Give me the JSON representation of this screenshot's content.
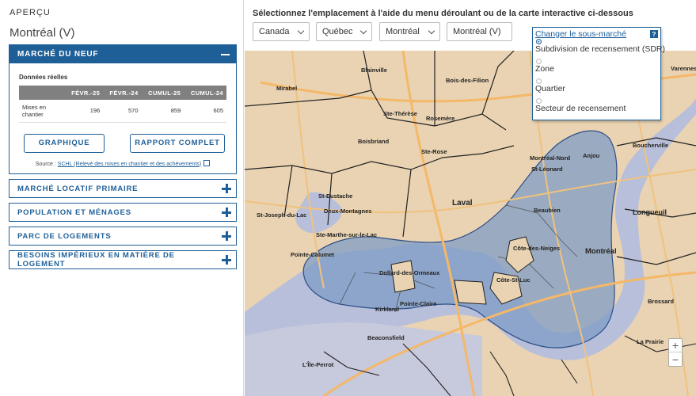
{
  "panel": {
    "overview_label": "APERÇU",
    "geo_name": "Montréal (V)",
    "open_section": {
      "title": "MARCHÉ DU NEUF",
      "data_label": "Données réelles",
      "columns": [
        "FÉVR.-25",
        "FÉVR.-24",
        "CUMUL-25",
        "CUMUL-24"
      ],
      "row_label": "Mises en chantier",
      "row_values": [
        "196",
        "570",
        "859",
        "605"
      ],
      "button_chart": "GRAPHIQUE",
      "button_report": "RAPPORT COMPLET",
      "source_prefix": "Source : ",
      "source_link": "SCHL (Relevé des mises en chantier et des achèvements)"
    },
    "sections": [
      "MARCHÉ LOCATIF PRIMAIRE",
      "POPULATION ET MÉNAGES",
      "PARC DE LOGEMENTS",
      "BESOINS IMPÉRIEUX EN MATIÈRE DE LOGEMENT"
    ]
  },
  "header": {
    "instruction": "Sélectionnez l'emplacement à l'aide du menu déroulant ou de la carte interactive ci-dessous",
    "selects": [
      "Canada",
      "Québec",
      "Montréal",
      "Montréal (V)"
    ]
  },
  "submarket": {
    "title": "Changer le sous-marché",
    "help": "?",
    "options": [
      "Subdivision de recensement (SDR)",
      "Zone",
      "Quartier",
      "Secteur de recensement"
    ],
    "selected_index": 0
  },
  "map": {
    "labels": {
      "blainville": "Blainville",
      "mirabel": "Mirabel",
      "ste_therese": "Ste-Thérèse",
      "boisdesfilion": "Bois-des-Filion",
      "rosemere": "Rosemère",
      "boisbriand": "Boisbriand",
      "sterose": "Ste-Rose",
      "steustache": "St-Eustache",
      "deuxmontagnes": "Deux-Montagnes",
      "laval": "Laval",
      "stjoseph": "St-Joseph-du-Lac",
      "stemarthe": "Ste-Marthe-sur-le-Lac",
      "pointecalumet": "Pointe-Calumet",
      "montrealnord": "Montréal-Nord",
      "stleonard": "St-Léonard",
      "anjou": "Anjou",
      "beaubien": "Beaubien",
      "boucherville": "Boucherville",
      "longueuil": "Longueuil",
      "varennes": "Varennes",
      "montreal": "Montréal",
      "cotedesneiges": "Côte-des-Neiges",
      "cotestluc": "Côte-St-Luc",
      "dollard": "Dollard-des-Ormeaux",
      "kirkland": "Kirkland",
      "pointeclaire": "Pointe-Claire",
      "beaconsfield": "Beaconsfield",
      "brossard": "Brossard",
      "laprairie": "La Prairie",
      "ileperrot": "L'Île-Perrot"
    }
  },
  "map_controls": {
    "zoom_in": "+",
    "zoom_out": "−"
  },
  "colors": {
    "accent": "#1f5f98",
    "highlight_fill": "#7f9cc4",
    "water": "#b8bfda",
    "land": "#e9d3b2"
  }
}
